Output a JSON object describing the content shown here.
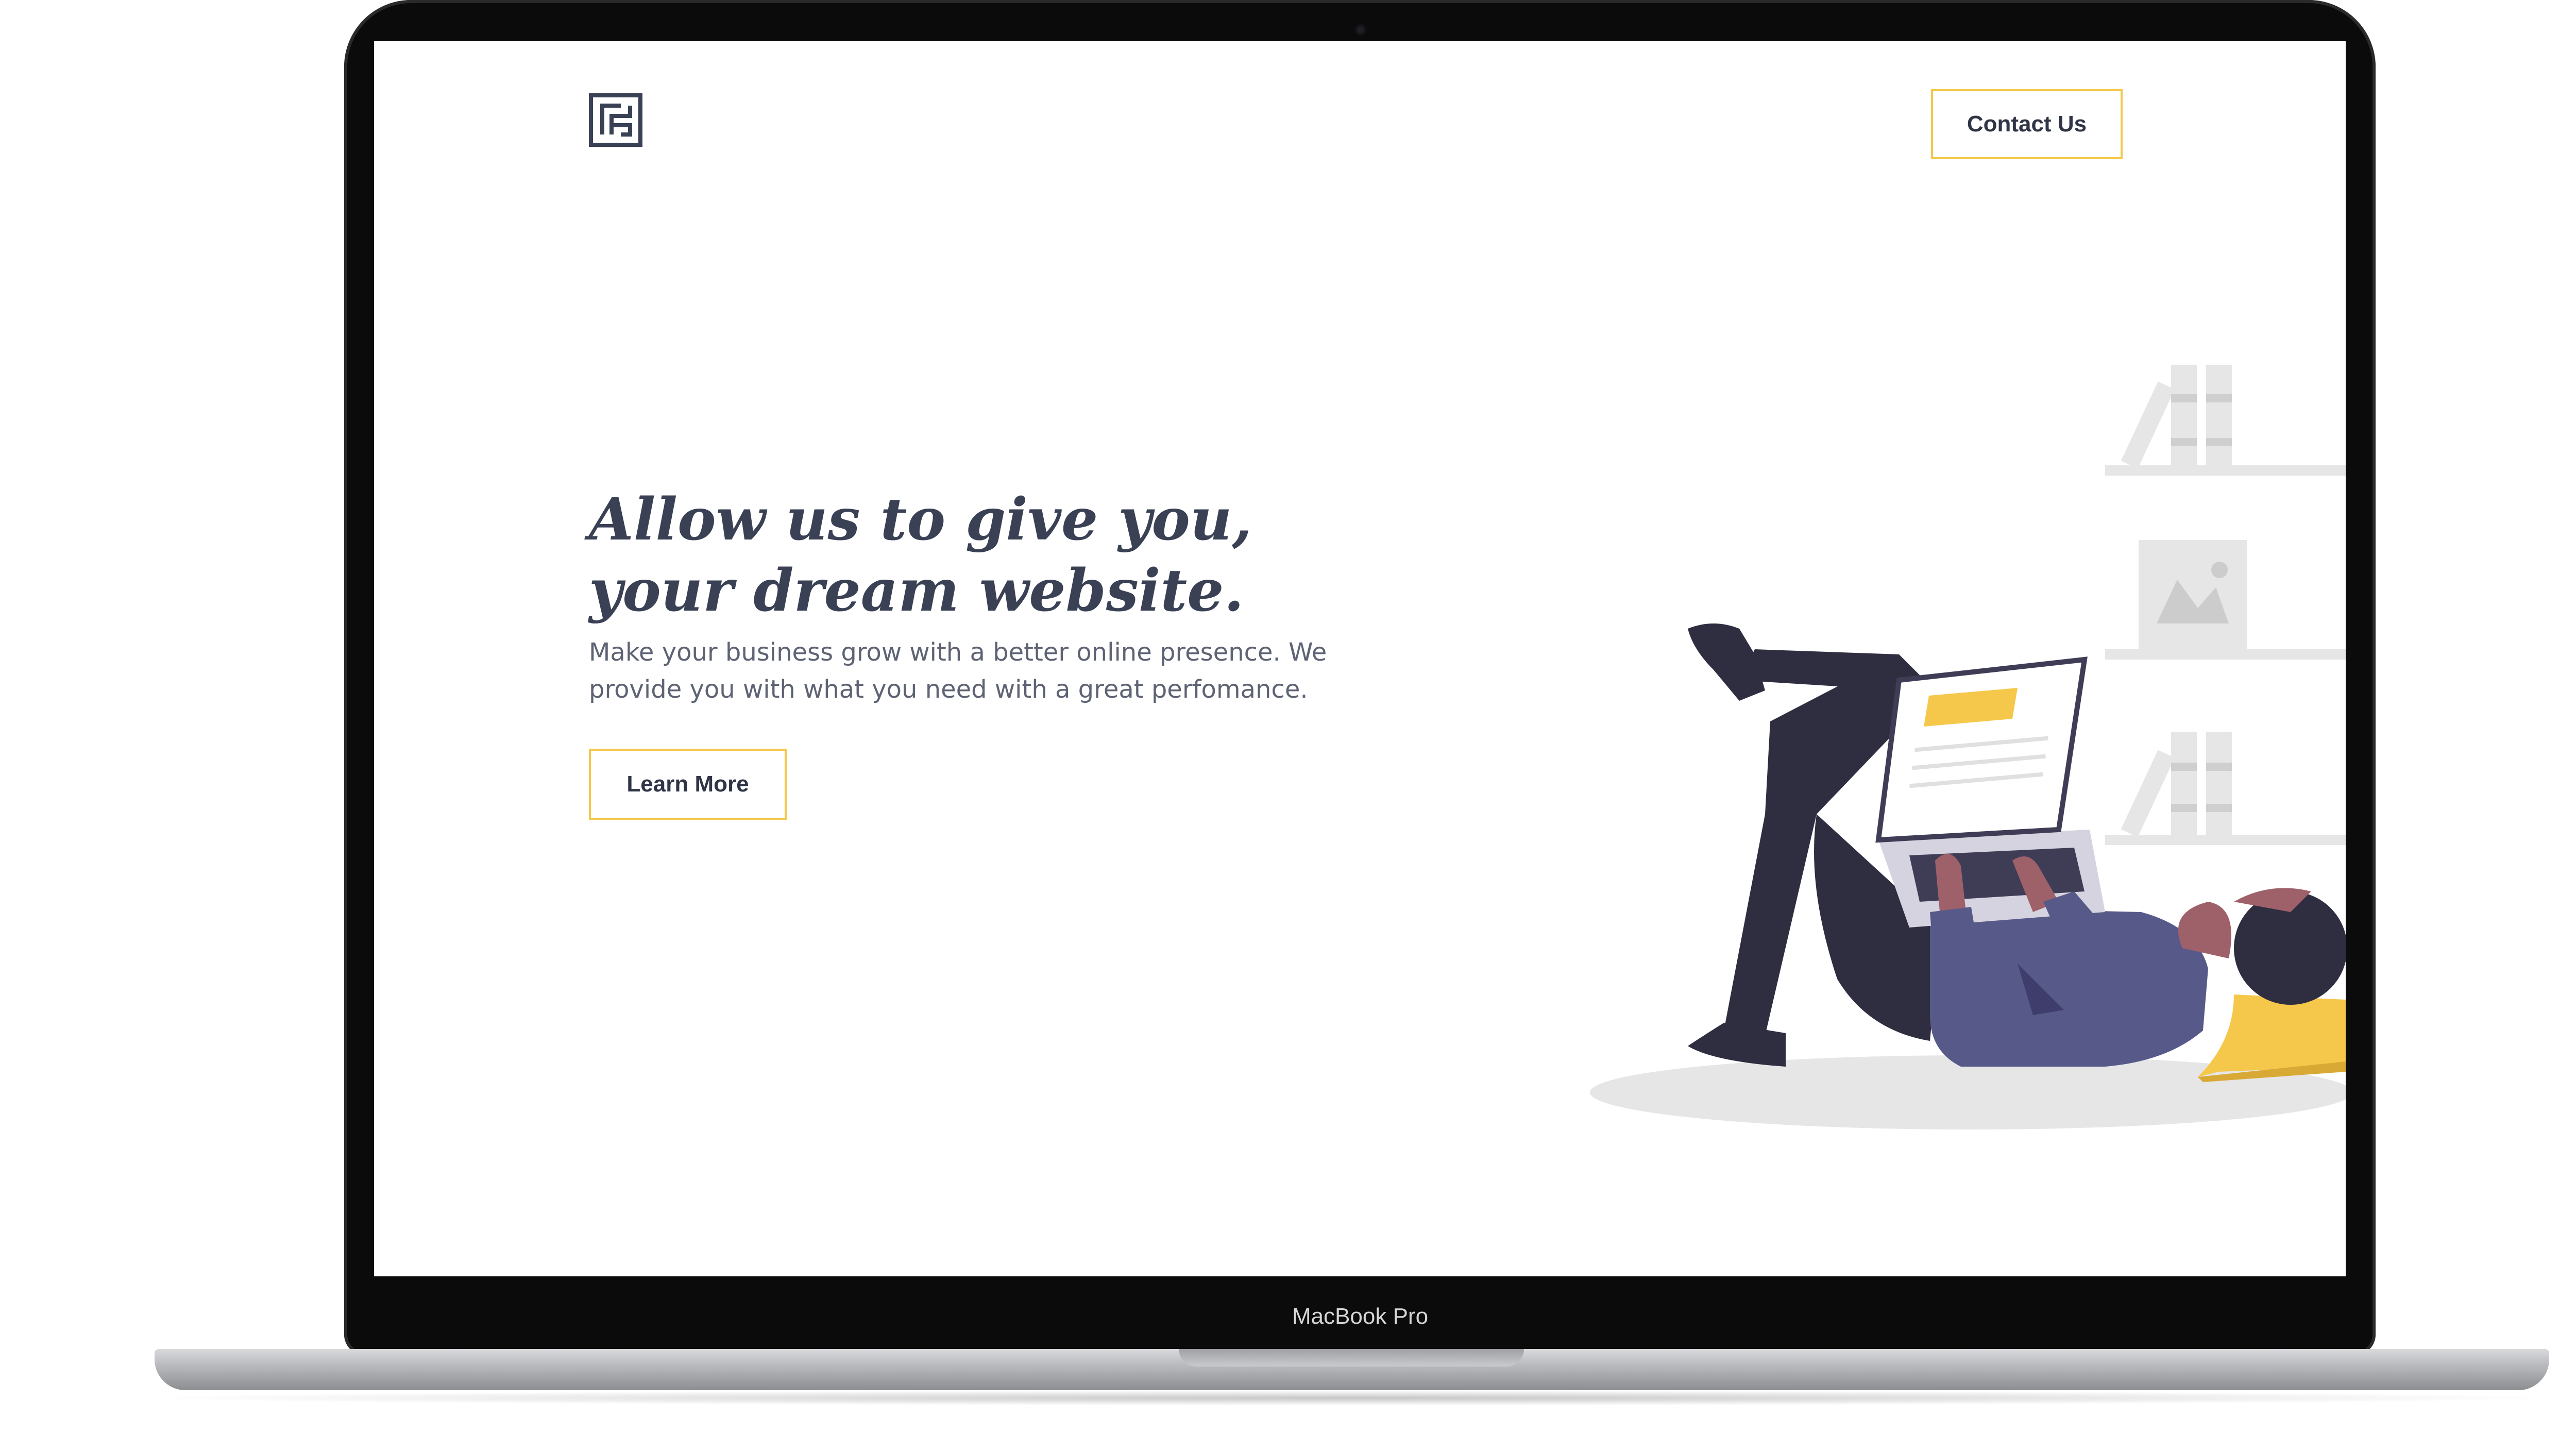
{
  "device": {
    "model_label": "MacBook Pro"
  },
  "header": {
    "logo_icon": "maze-square-logo-icon",
    "contact_label": "Contact Us"
  },
  "hero": {
    "title": "Allow us to give you, your dream website.",
    "subtitle": "Make your business grow with a better online presence. We provide you with what you need with a great perfomance.",
    "cta_label": "Learn More"
  },
  "colors": {
    "accent": "#f5c84b",
    "heading": "#3a4155",
    "body_text": "#5e6374",
    "figure_dark": "#2f2e41",
    "figure_shirt": "#575a89",
    "figure_skin": "#9e616a",
    "shelf_gray": "#e6e6e6"
  },
  "illustration": {
    "icon": "person-lying-with-laptop-illustration"
  }
}
